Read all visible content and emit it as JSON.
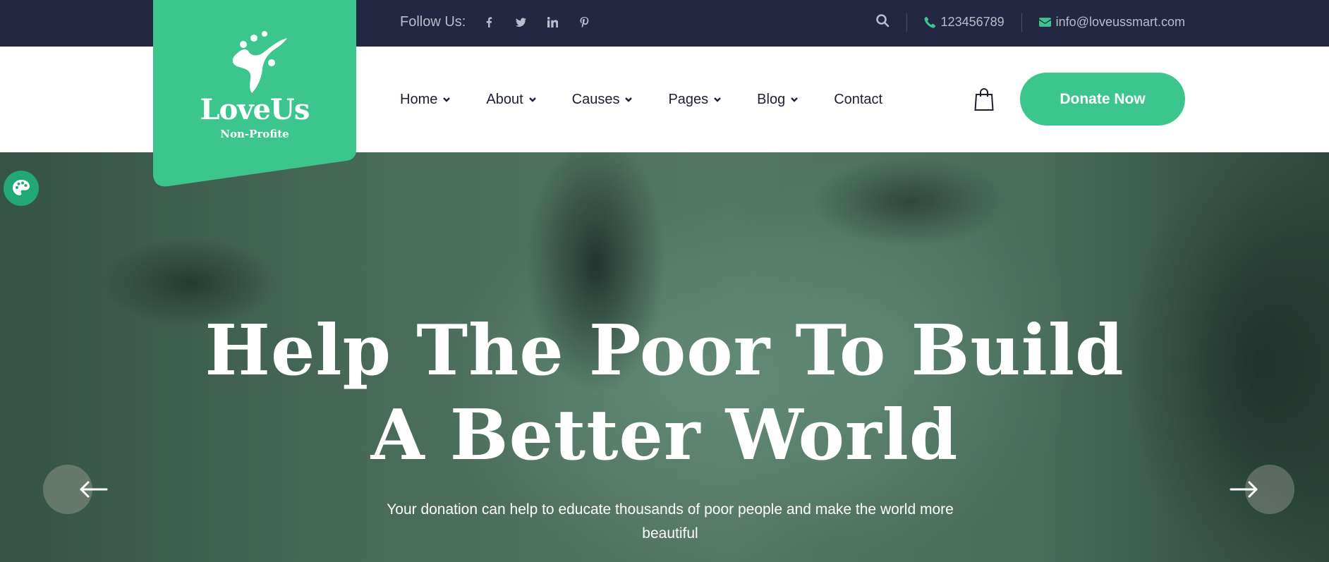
{
  "topbar": {
    "follow_label": "Follow Us:",
    "social": [
      "facebook-icon",
      "twitter-icon",
      "linkedin-icon",
      "pinterest-icon"
    ],
    "phone": "123456789",
    "email": "info@loveussmart.com"
  },
  "logo": {
    "name": "LoveUs",
    "tagline": "Non-Profite"
  },
  "nav": {
    "items": [
      {
        "label": "Home"
      },
      {
        "label": "About"
      },
      {
        "label": "Causes"
      },
      {
        "label": "Pages"
      },
      {
        "label": "Blog"
      },
      {
        "label": "Contact"
      }
    ],
    "donate_label": "Donate Now"
  },
  "hero": {
    "title_line1": "Help The Poor To Build",
    "title_line2": "A Better World",
    "subtitle": "Your donation can help to educate thousands of poor people and make the world more beautiful"
  },
  "colors": {
    "accent": "#3cc68e",
    "topbar": "#232742",
    "text_dark": "#1d2033"
  }
}
